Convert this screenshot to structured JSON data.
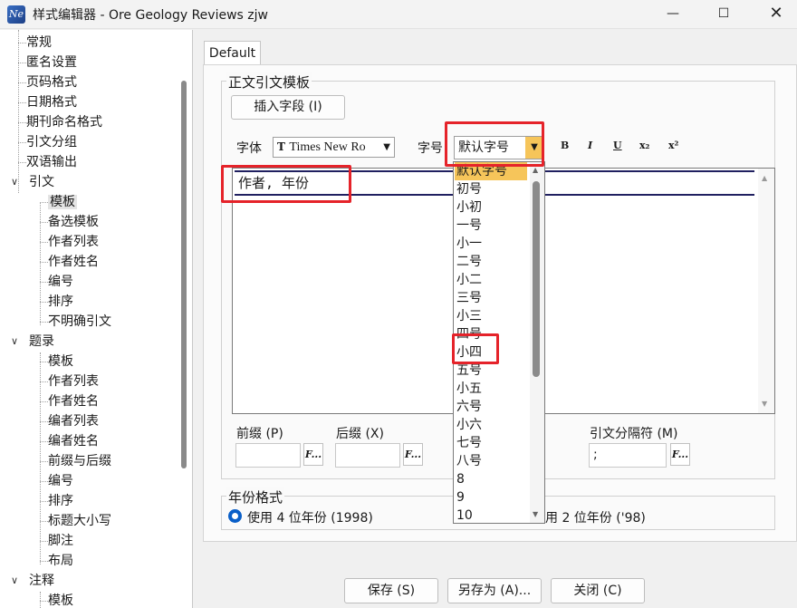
{
  "window": {
    "title": "样式编辑器 - Ore Geology Reviews zjw",
    "app_icon_text": "Ne",
    "minimize_glyph": "—",
    "maximize_glyph": "☐",
    "close_glyph": "✕"
  },
  "tree": {
    "items": [
      {
        "label": "常规"
      },
      {
        "label": "匿名设置"
      },
      {
        "label": "页码格式"
      },
      {
        "label": "日期格式"
      },
      {
        "label": "期刊命名格式"
      },
      {
        "label": "引文分组"
      },
      {
        "label": "双语输出"
      },
      {
        "label": "引文",
        "expanded": true
      },
      {
        "label": "模板",
        "selected": true
      },
      {
        "label": "备选模板"
      },
      {
        "label": "作者列表"
      },
      {
        "label": "作者姓名"
      },
      {
        "label": "编号"
      },
      {
        "label": "排序"
      },
      {
        "label": "不明确引文"
      },
      {
        "label": "题录",
        "expanded": true
      },
      {
        "label": "模板"
      },
      {
        "label": "作者列表"
      },
      {
        "label": "作者姓名"
      },
      {
        "label": "编者列表"
      },
      {
        "label": "编者姓名"
      },
      {
        "label": "前缀与后缀"
      },
      {
        "label": "编号"
      },
      {
        "label": "排序"
      },
      {
        "label": "标题大小写"
      },
      {
        "label": "脚注"
      },
      {
        "label": "布局"
      },
      {
        "label": "注释",
        "expanded": true
      },
      {
        "label": "模板"
      }
    ],
    "expander_glyph": "∨"
  },
  "tab": {
    "label": "Default"
  },
  "template_group": {
    "title": "正文引文模板",
    "insert_field_button": "插入字段 (I)",
    "font_label": "字体",
    "font_icon": "T",
    "font_value": "Times New Ro",
    "size_label": "字号",
    "size_value": "默认字号",
    "format_buttons": [
      "B",
      "I",
      "U",
      "x₂",
      "x²"
    ],
    "editor_text": "作者, 年份"
  },
  "font_size_options": [
    "默认字号",
    "初号",
    "小初",
    "一号",
    "小一",
    "二号",
    "小二",
    "三号",
    "小三",
    "四号",
    "小四",
    "五号",
    "小五",
    "六号",
    "小六",
    "七号",
    "八号",
    "8",
    "9",
    "10"
  ],
  "affixes": {
    "prefix_label": "前缀 (P)",
    "suffix_label": "后缀 (X)",
    "separator_label": "引文分隔符 (M)",
    "prefix_value": "",
    "suffix_value": "",
    "separator_value": ";",
    "f_button": "F..."
  },
  "year_group": {
    "title": "年份格式",
    "option_4digit": "使用 4 位年份 (1998)",
    "option_2digit": "用 2 位年份 ('98)",
    "selected": "4digit"
  },
  "buttons": {
    "save": "保存 (S)",
    "save_as": "另存为 (A)...",
    "close": "关闭 (C)"
  },
  "colors": {
    "highlight_red": "#e5232a",
    "selected_item": "#f6c55a",
    "radio_blue": "#0a5fc8"
  }
}
